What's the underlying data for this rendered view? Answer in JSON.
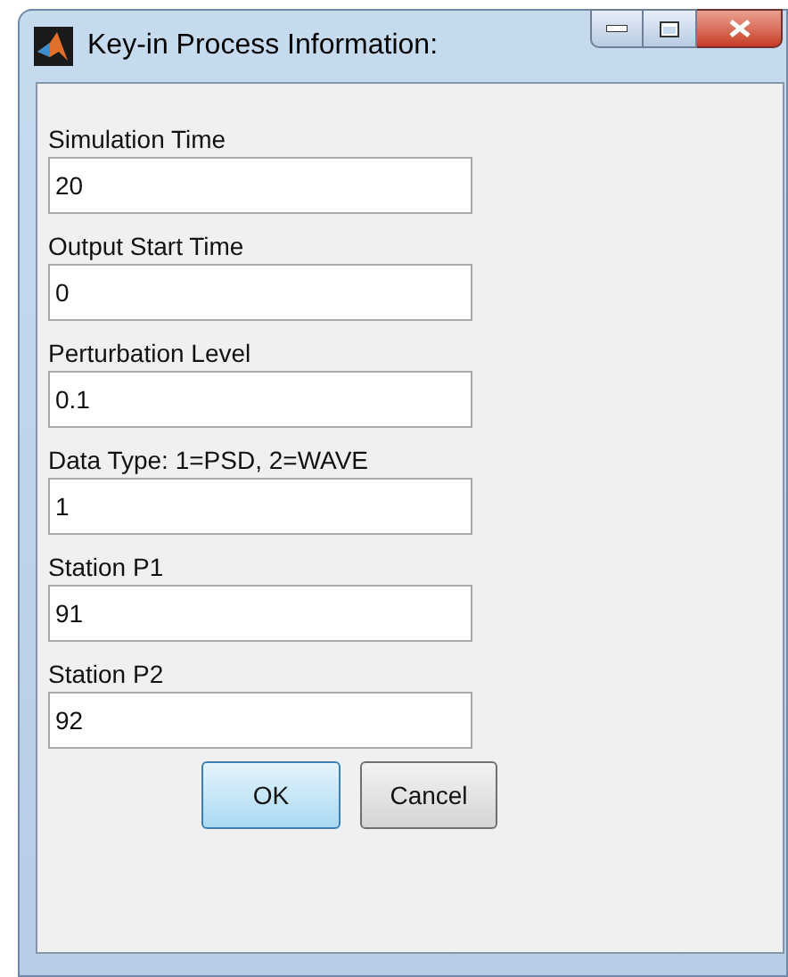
{
  "window": {
    "title": "Key-in Process Information:"
  },
  "fields": [
    {
      "label": "Simulation Time",
      "value": "20"
    },
    {
      "label": "Output Start Time",
      "value": "0"
    },
    {
      "label": "Perturbation Level",
      "value": "0.1"
    },
    {
      "label": "Data Type: 1=PSD, 2=WAVE",
      "value": "1"
    },
    {
      "label": "Station P1",
      "value": "91"
    },
    {
      "label": "Station P2",
      "value": "92"
    }
  ],
  "buttons": [
    {
      "label": "OK",
      "default": true
    },
    {
      "label": "Cancel",
      "default": false
    }
  ]
}
